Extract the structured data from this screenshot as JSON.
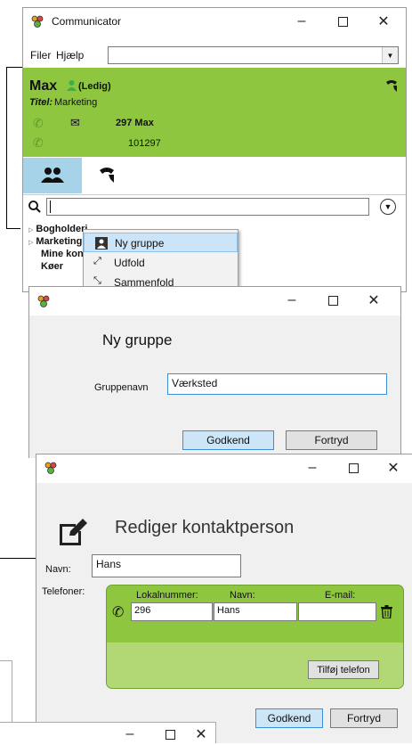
{
  "communicator": {
    "title": "Communicator",
    "menu": [
      "Filer",
      "Hjælp"
    ],
    "user": {
      "name": "Max",
      "status": "(Ledig)",
      "title_label": "Titel:",
      "title_value": "Marketing",
      "phone_name": "297 Max",
      "number": "101297"
    },
    "tree": [
      "Bogholderi",
      "Marketing",
      "Mine kontakter",
      "Køer"
    ]
  },
  "context_menu": {
    "items": [
      "Ny gruppe",
      "Udfold",
      "Sammenfold"
    ]
  },
  "ny_gruppe": {
    "heading": "Ny gruppe",
    "label": "Gruppenavn",
    "value": "Værksted",
    "ok": "Godkend",
    "cancel": "Fortryd"
  },
  "rediger": {
    "heading": "Rediger kontaktperson",
    "name_label": "Navn:",
    "name_value": "Hans",
    "phones_label": "Telefoner:",
    "columns": [
      "Lokalnummer:",
      "Navn:",
      "E-mail:"
    ],
    "row": {
      "lokal": "296",
      "navn": "Hans",
      "email": ""
    },
    "add_phone": "Tilføj telefon",
    "ok": "Godkend",
    "cancel": "Fortryd"
  },
  "caption": {
    "minimize": "–",
    "close": "✕"
  },
  "colors": {
    "green": "#8ec63f",
    "dark_green": "#2e7d1e",
    "accent_blue": "#3c8fd6"
  }
}
